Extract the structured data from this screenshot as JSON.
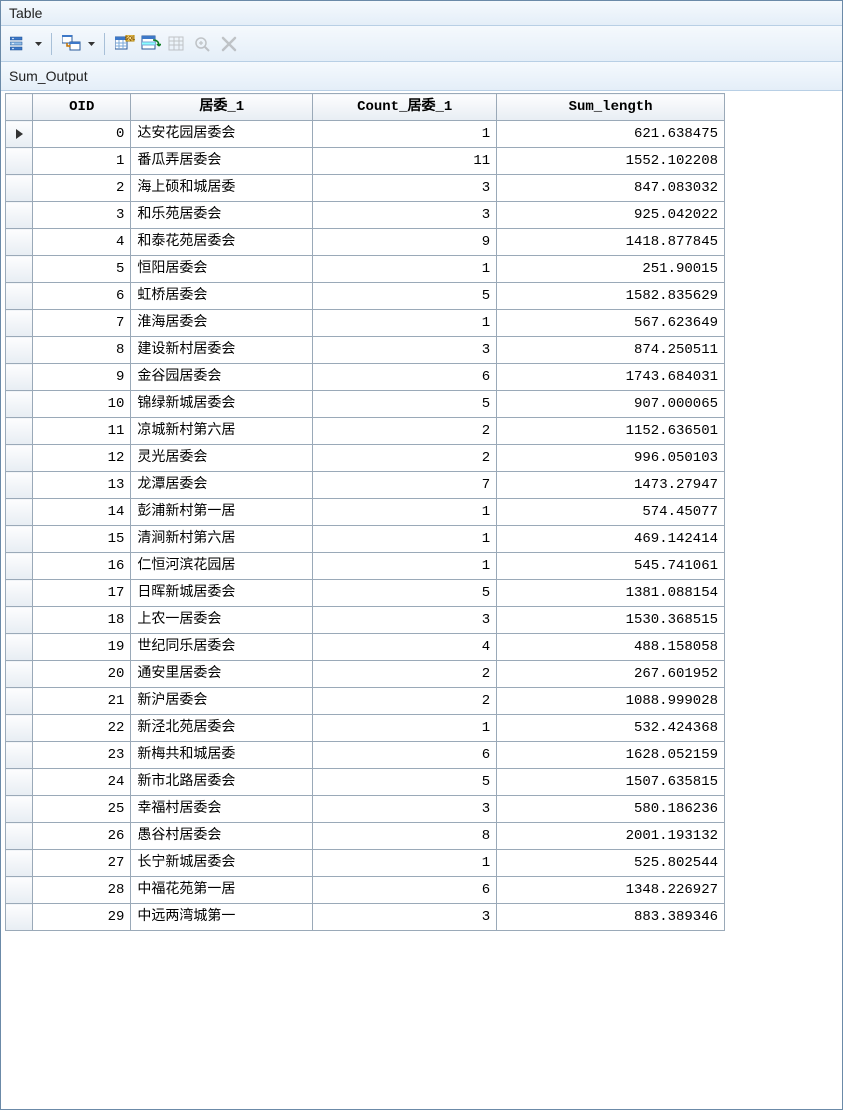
{
  "window": {
    "title": "Table",
    "subtitle": "Sum_Output"
  },
  "columns": {
    "oid": "OID",
    "name": "居委_1",
    "count": "Count_居委_1",
    "sum": "Sum_length"
  },
  "selected_row": 0,
  "rows": [
    {
      "oid": 0,
      "name": "达安花园居委会",
      "count": 1,
      "sum": "621.638475"
    },
    {
      "oid": 1,
      "name": "番瓜弄居委会",
      "count": 11,
      "sum": "1552.102208"
    },
    {
      "oid": 2,
      "name": "海上硕和城居委",
      "count": 3,
      "sum": "847.083032"
    },
    {
      "oid": 3,
      "name": "和乐苑居委会",
      "count": 3,
      "sum": "925.042022"
    },
    {
      "oid": 4,
      "name": "和泰花苑居委会",
      "count": 9,
      "sum": "1418.877845"
    },
    {
      "oid": 5,
      "name": "恒阳居委会",
      "count": 1,
      "sum": "251.90015"
    },
    {
      "oid": 6,
      "name": "虹桥居委会",
      "count": 5,
      "sum": "1582.835629"
    },
    {
      "oid": 7,
      "name": "淮海居委会",
      "count": 1,
      "sum": "567.623649"
    },
    {
      "oid": 8,
      "name": "建设新村居委会",
      "count": 3,
      "sum": "874.250511"
    },
    {
      "oid": 9,
      "name": "金谷园居委会",
      "count": 6,
      "sum": "1743.684031"
    },
    {
      "oid": 10,
      "name": "锦绿新城居委会",
      "count": 5,
      "sum": "907.000065"
    },
    {
      "oid": 11,
      "name": "凉城新村第六居",
      "count": 2,
      "sum": "1152.636501"
    },
    {
      "oid": 12,
      "name": "灵光居委会",
      "count": 2,
      "sum": "996.050103"
    },
    {
      "oid": 13,
      "name": "龙潭居委会",
      "count": 7,
      "sum": "1473.27947"
    },
    {
      "oid": 14,
      "name": "彭浦新村第一居",
      "count": 1,
      "sum": "574.45077"
    },
    {
      "oid": 15,
      "name": "清涧新村第六居",
      "count": 1,
      "sum": "469.142414"
    },
    {
      "oid": 16,
      "name": "仁恒河滨花园居",
      "count": 1,
      "sum": "545.741061"
    },
    {
      "oid": 17,
      "name": "日晖新城居委会",
      "count": 5,
      "sum": "1381.088154"
    },
    {
      "oid": 18,
      "name": "上农一居委会",
      "count": 3,
      "sum": "1530.368515"
    },
    {
      "oid": 19,
      "name": "世纪同乐居委会",
      "count": 4,
      "sum": "488.158058"
    },
    {
      "oid": 20,
      "name": "通安里居委会",
      "count": 2,
      "sum": "267.601952"
    },
    {
      "oid": 21,
      "name": "新沪居委会",
      "count": 2,
      "sum": "1088.999028"
    },
    {
      "oid": 22,
      "name": "新泾北苑居委会",
      "count": 1,
      "sum": "532.424368"
    },
    {
      "oid": 23,
      "name": "新梅共和城居委",
      "count": 6,
      "sum": "1628.052159"
    },
    {
      "oid": 24,
      "name": "新市北路居委会",
      "count": 5,
      "sum": "1507.635815"
    },
    {
      "oid": 25,
      "name": "幸福村居委会",
      "count": 3,
      "sum": "580.186236"
    },
    {
      "oid": 26,
      "name": "愚谷村居委会",
      "count": 8,
      "sum": "2001.193132"
    },
    {
      "oid": 27,
      "name": "长宁新城居委会",
      "count": 1,
      "sum": "525.802544"
    },
    {
      "oid": 28,
      "name": "中福花苑第一居",
      "count": 6,
      "sum": "1348.226927"
    },
    {
      "oid": 29,
      "name": "中远两湾城第一",
      "count": 3,
      "sum": "883.389346"
    }
  ],
  "toolbar": {
    "list_options": "table-options",
    "related_tables": "related-tables",
    "select_by_attributes": "select-by-attributes",
    "switch_selection": "switch-selection",
    "clear_selection": "clear-selection",
    "zoom_selected": "zoom-to-selected",
    "delete": "delete"
  }
}
